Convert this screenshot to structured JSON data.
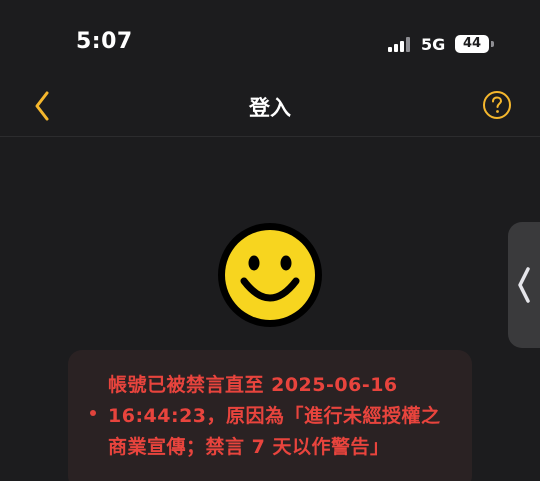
{
  "status_bar": {
    "time": "5:07",
    "network": "5G",
    "battery": "44"
  },
  "nav": {
    "title": "登入",
    "back_icon": "chevron-left-icon",
    "help_icon": "question-circle-icon"
  },
  "emoji": {
    "icon": "smiley-face-icon"
  },
  "error": {
    "lines": [
      "帳號已被禁言直至 2025-06-16",
      "16:44:23，原因為「進行未經授權之",
      "商業宣傳；禁言 7 天以作警告」"
    ]
  },
  "colors": {
    "background": "#1c1c1e",
    "accent": "#f5b72d",
    "error": "#e8443d",
    "card": "#2a2223"
  }
}
